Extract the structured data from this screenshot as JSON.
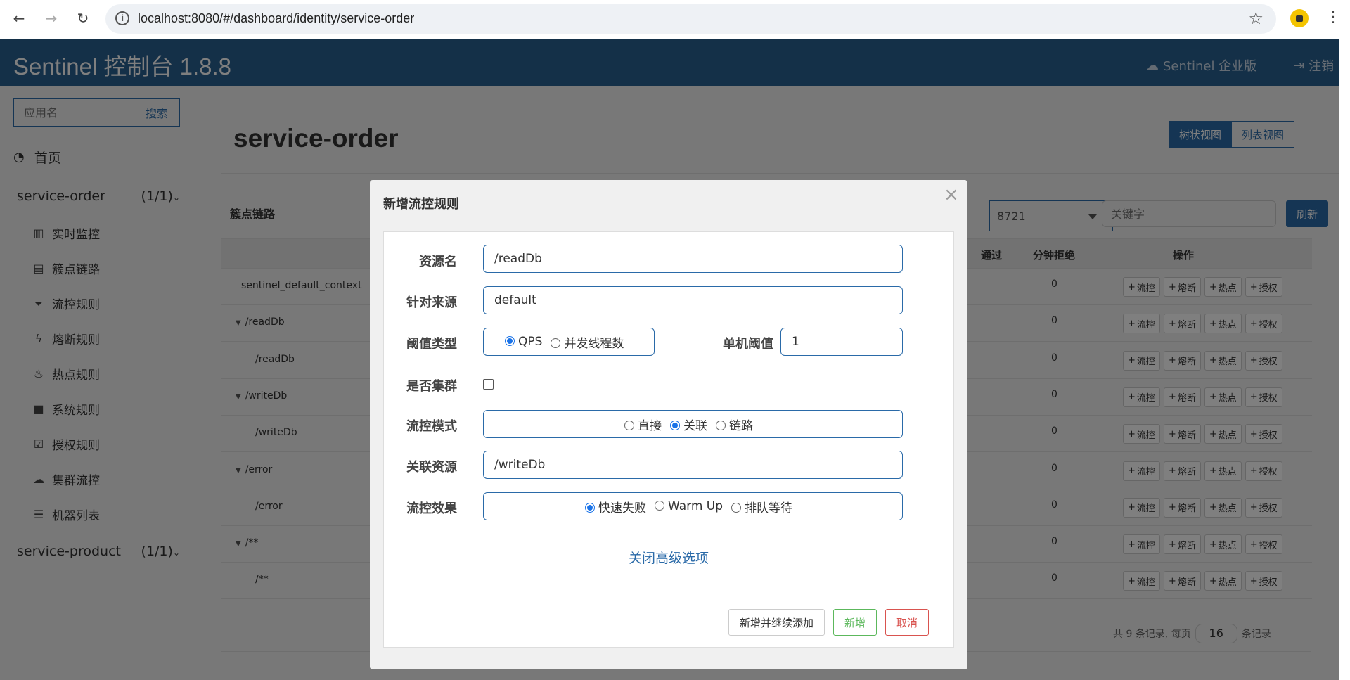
{
  "browser": {
    "url": "localhost:8080/#/dashboard/identity/service-order"
  },
  "header": {
    "brand": "Sentinel 控制台 1.8.8",
    "enterprise_label": "Sentinel 企业版",
    "logout_label": "注销"
  },
  "sidebar": {
    "search_placeholder": "应用名",
    "search_button": "搜索",
    "home_label": "首页",
    "apps": [
      {
        "name": "service-order",
        "count": "(1/1)"
      },
      {
        "name": "service-product",
        "count": "(1/1)"
      }
    ],
    "menu": [
      {
        "label": "实时监控",
        "icon": "bar-chart-icon"
      },
      {
        "label": "簇点链路",
        "icon": "list-alt-icon"
      },
      {
        "label": "流控规则",
        "icon": "filter-icon"
      },
      {
        "label": "熔断规则",
        "icon": "flash-icon"
      },
      {
        "label": "热点规则",
        "icon": "fire-icon"
      },
      {
        "label": "系统规则",
        "icon": "lock-icon"
      },
      {
        "label": "授权规则",
        "icon": "check-icon"
      },
      {
        "label": "集群流控",
        "icon": "cloud-icon"
      },
      {
        "label": "机器列表",
        "icon": "th-list-icon"
      }
    ]
  },
  "main": {
    "title": "service-order",
    "view_tree": "树状视图",
    "view_list": "列表视图",
    "panel_title": "簇点链路",
    "machine_value": "8721",
    "keyword_placeholder": "关键字",
    "refresh": "刷新",
    "columns": {
      "pass": "通过",
      "reject": "分钟拒绝",
      "ops": "操作"
    },
    "rows": [
      {
        "resource": "sentinel_default_context",
        "level": 0,
        "caret": false,
        "reject": "0"
      },
      {
        "resource": "/readDb",
        "level": 1,
        "caret": true,
        "reject": "0"
      },
      {
        "resource": "/readDb",
        "level": 2,
        "caret": false,
        "reject": "0"
      },
      {
        "resource": "/writeDb",
        "level": 1,
        "caret": true,
        "reject": "0"
      },
      {
        "resource": "/writeDb",
        "level": 2,
        "caret": false,
        "reject": "0"
      },
      {
        "resource": "/error",
        "level": 1,
        "caret": true,
        "reject": "0"
      },
      {
        "resource": "/error",
        "level": 2,
        "caret": false,
        "reject": "0"
      },
      {
        "resource": "/**",
        "level": 1,
        "caret": true,
        "reject": "0"
      },
      {
        "resource": "/**",
        "level": 2,
        "caret": false,
        "reject": "0"
      }
    ],
    "op_buttons": [
      "流控",
      "熔断",
      "热点",
      "授权"
    ],
    "pager": {
      "prefix": "共 9 条记录, 每页",
      "page_size": "16",
      "suffix": "条记录"
    }
  },
  "modal": {
    "title": "新增流控规则",
    "close": "×",
    "resource_label": "资源名",
    "resource_value": "/readDb",
    "origin_label": "针对来源",
    "origin_value": "default",
    "threshold_type_label": "阈值类型",
    "threshold_types": [
      "QPS",
      "并发线程数"
    ],
    "threshold_type_selected": "QPS",
    "single_threshold_label": "单机阈值",
    "single_threshold_value": "1",
    "cluster_label": "是否集群",
    "cluster_checked": false,
    "mode_label": "流控模式",
    "modes": [
      "直接",
      "关联",
      "链路"
    ],
    "mode_selected": "关联",
    "ref_resource_label": "关联资源",
    "ref_resource_value": "/writeDb",
    "effect_label": "流控效果",
    "effects": [
      "快速失败",
      "Warm Up",
      "排队等待"
    ],
    "effect_selected": "快速失败",
    "advanced_link": "关闭高级选项",
    "btn_add_continue": "新增并继续添加",
    "btn_add": "新增",
    "btn_cancel": "取消"
  },
  "colors": {
    "header_bg": "#286090",
    "primary": "#2a6aa8",
    "success": "#5cb85c",
    "danger": "#d9534f"
  }
}
